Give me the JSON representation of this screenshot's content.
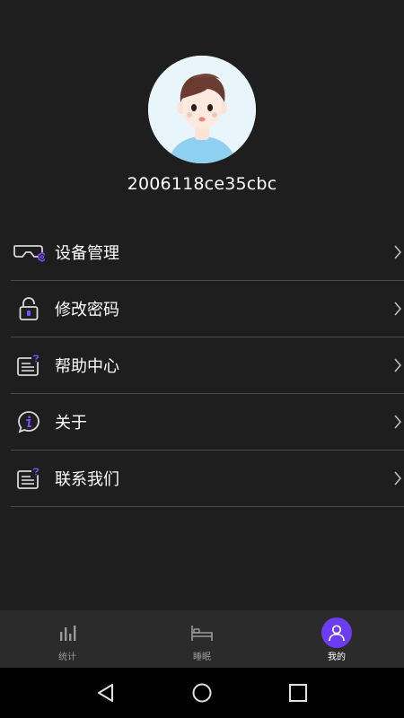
{
  "profile": {
    "username": "2006118ce35cbc",
    "avatar_icon": "user-avatar-illustration"
  },
  "menu": {
    "items": [
      {
        "label": "设备管理",
        "icon": "vr-headset-settings-icon"
      },
      {
        "label": "修改密码",
        "icon": "lock-icon"
      },
      {
        "label": "帮助中心",
        "icon": "help-document-icon"
      },
      {
        "label": "关于",
        "icon": "info-chat-icon"
      },
      {
        "label": "联系我们",
        "icon": "contact-document-icon"
      }
    ]
  },
  "tabbar": {
    "tabs": [
      {
        "label": "统计",
        "icon": "bar-chart-icon",
        "active": false
      },
      {
        "label": "睡眠",
        "icon": "bed-icon",
        "active": false
      },
      {
        "label": "我的",
        "icon": "person-icon",
        "active": true
      }
    ]
  },
  "colors": {
    "background": "#1e1e1e",
    "accent": "#6c3cf0",
    "icon_accent": "#7b4dff",
    "divider": "#4a4a4a",
    "tabbar": "#2b2b2b"
  },
  "system_nav": {
    "icons": [
      "back-triangle-icon",
      "home-circle-icon",
      "recents-square-icon"
    ]
  }
}
